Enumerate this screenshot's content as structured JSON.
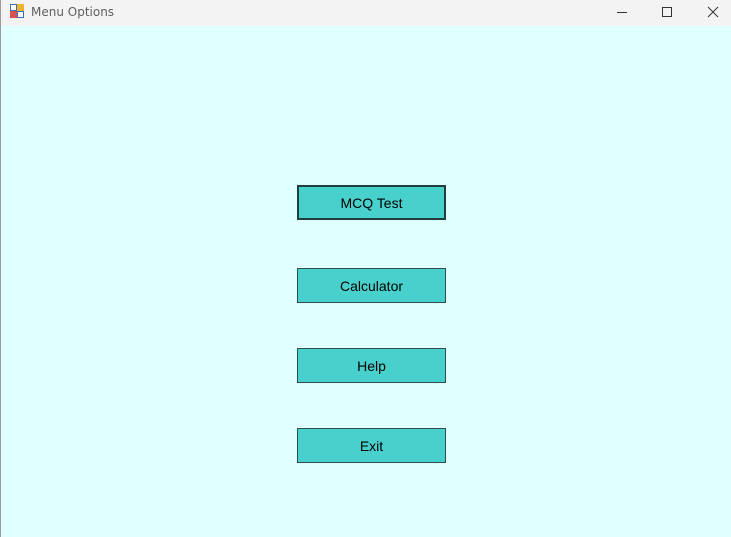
{
  "window": {
    "title": "Menu Options",
    "app_icon": "winforms-app-icon",
    "controls": {
      "minimize_icon": "minimize-icon",
      "maximize_icon": "maximize-icon",
      "close_icon": "close-icon"
    },
    "client_background": "#E0FFFF",
    "titlebar_background": "#F3F3F3"
  },
  "menu": {
    "button_color": "#48D1CC",
    "buttons": [
      {
        "label": "MCQ Test",
        "focused": true
      },
      {
        "label": "Calculator",
        "focused": false
      },
      {
        "label": "Help",
        "focused": false
      },
      {
        "label": "Exit",
        "focused": false
      }
    ]
  }
}
